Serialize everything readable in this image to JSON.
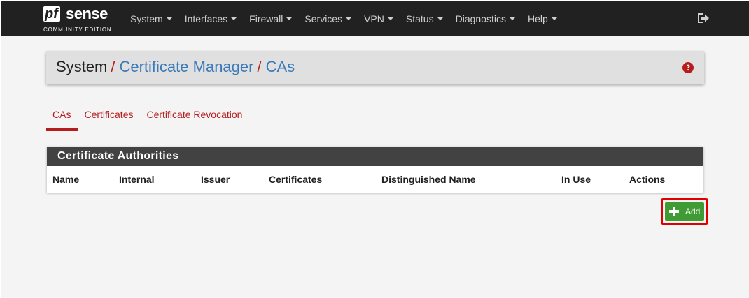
{
  "brand": {
    "pf": "pf",
    "sense": "sense",
    "edition": "COMMUNITY EDITION"
  },
  "nav": {
    "items": [
      {
        "label": "System"
      },
      {
        "label": "Interfaces"
      },
      {
        "label": "Firewall"
      },
      {
        "label": "Services"
      },
      {
        "label": "VPN"
      },
      {
        "label": "Status"
      },
      {
        "label": "Diagnostics"
      },
      {
        "label": "Help"
      }
    ],
    "logout_icon": "sign-out-icon"
  },
  "breadcrumb": {
    "items": [
      "System",
      "Certificate Manager",
      "CAs"
    ],
    "separator": "/",
    "help_icon": "question-circle-icon"
  },
  "tabs": [
    {
      "label": "CAs",
      "active": true
    },
    {
      "label": "Certificates",
      "active": false
    },
    {
      "label": "Certificate Revocation",
      "active": false
    }
  ],
  "table": {
    "title": "Certificate Authorities",
    "columns": [
      "Name",
      "Internal",
      "Issuer",
      "Certificates",
      "Distinguished Name",
      "In Use",
      "Actions"
    ],
    "rows": []
  },
  "actions": {
    "add_label": "Add",
    "add_icon": "plus-icon"
  },
  "colors": {
    "navbar": "#212121",
    "accent_red": "#b71c1c",
    "link_blue": "#3a7ab8",
    "panel_heading": "#424242",
    "add_green": "#3f9c35",
    "highlight_red": "#e00000"
  }
}
